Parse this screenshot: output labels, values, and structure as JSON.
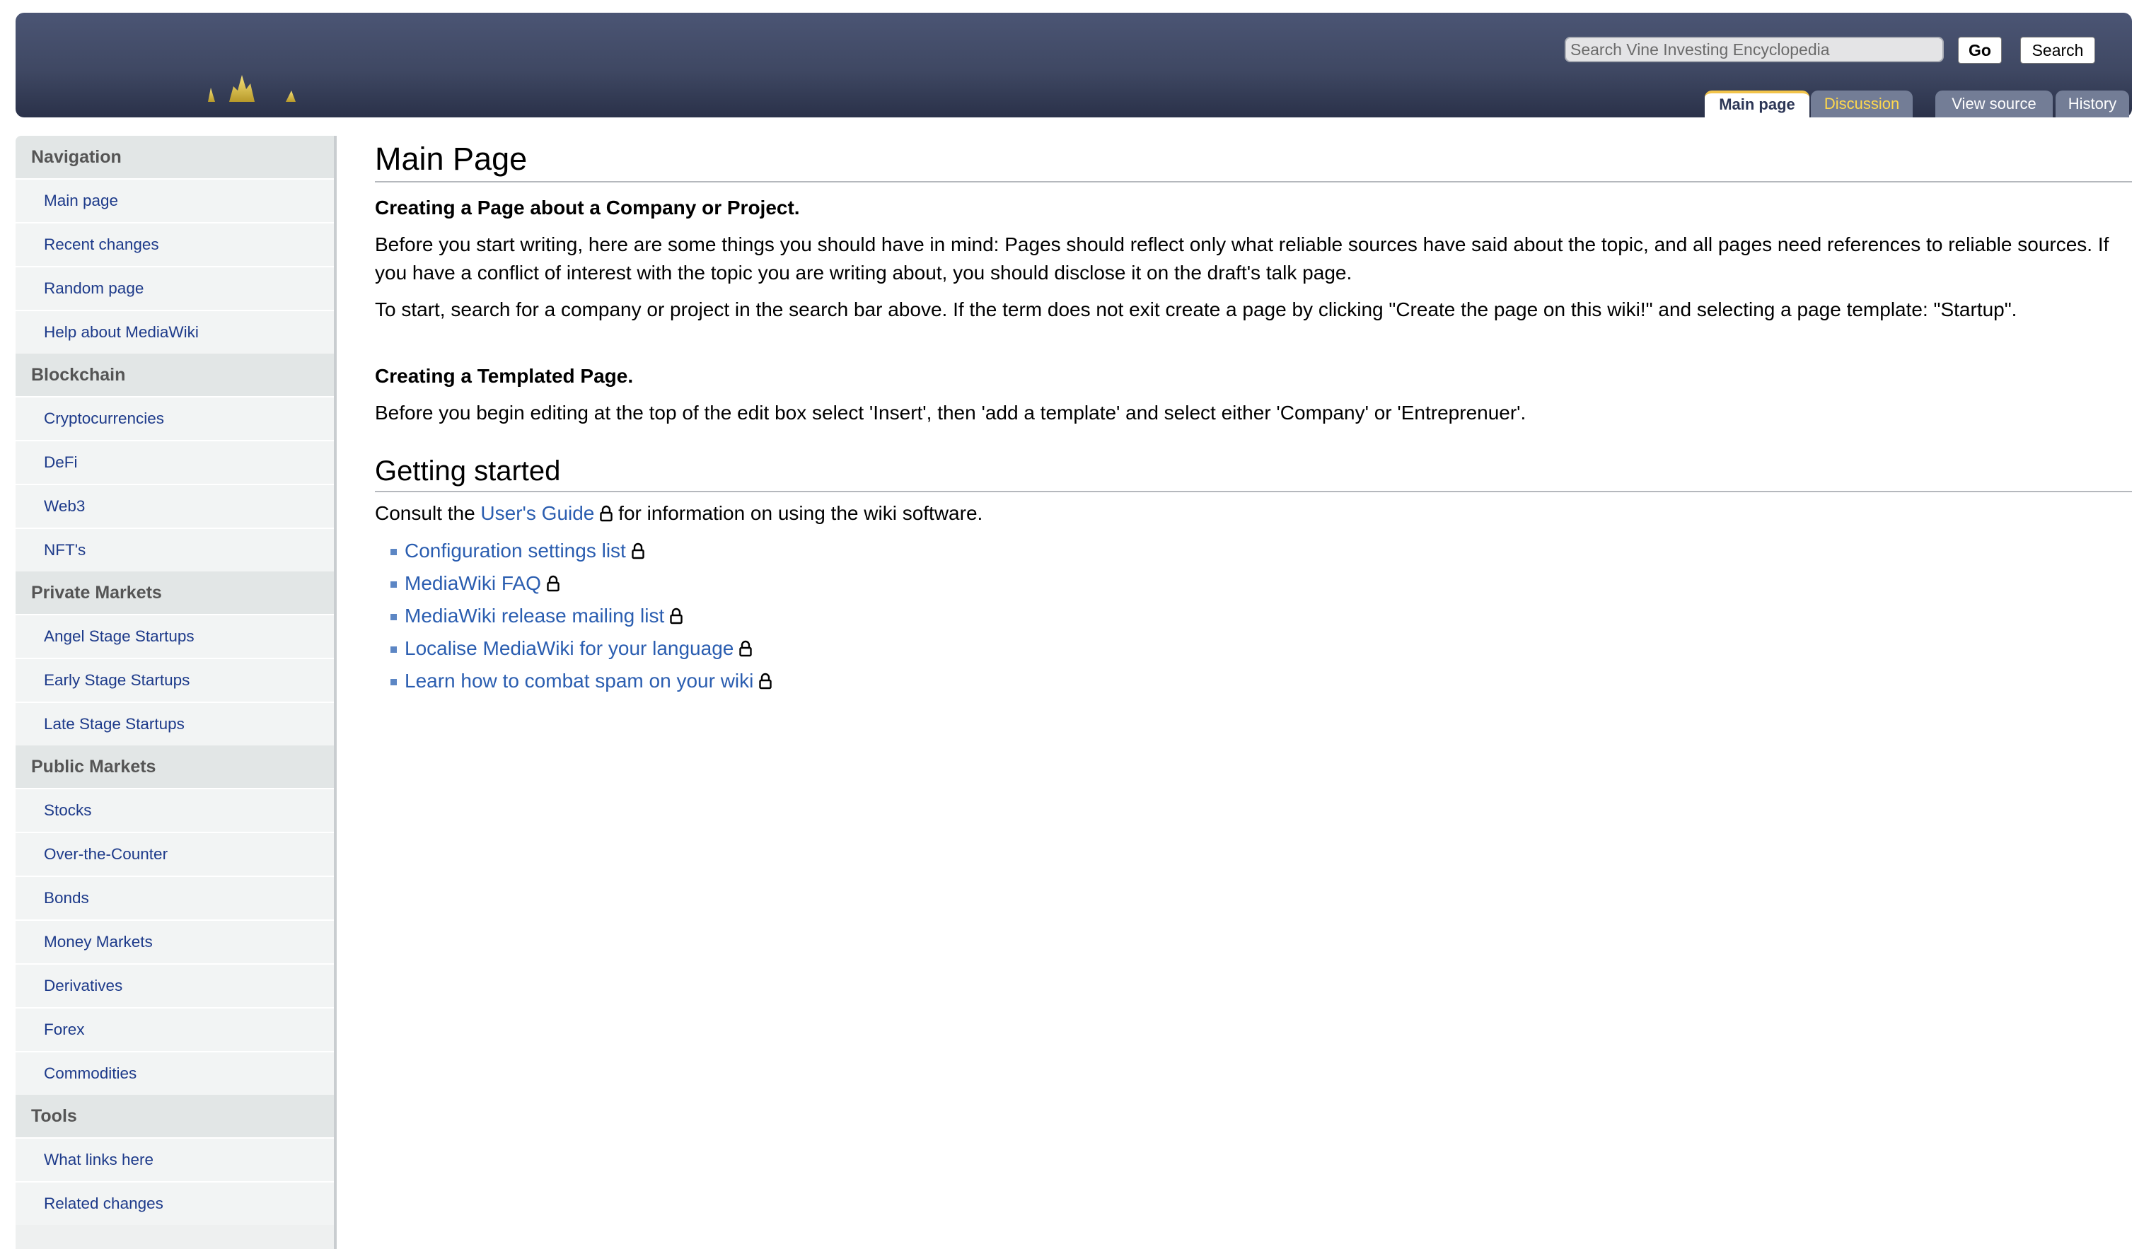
{
  "header": {
    "search_placeholder": "Search Vine Investing Encyclopedia",
    "go_label": "Go",
    "search_label": "Search",
    "tabs": {
      "main": "Main page",
      "discussion": "Discussion",
      "view_source": "View source",
      "history": "History"
    }
  },
  "sidebar": {
    "sections": [
      {
        "title": "Navigation",
        "items": [
          "Main page",
          "Recent changes",
          "Random page",
          "Help about MediaWiki"
        ]
      },
      {
        "title": "Blockchain",
        "items": [
          "Cryptocurrencies",
          "DeFi",
          "Web3",
          "NFT's"
        ]
      },
      {
        "title": "Private Markets",
        "items": [
          "Angel Stage Startups",
          "Early Stage Startups",
          "Late Stage Startups"
        ]
      },
      {
        "title": "Public Markets",
        "items": [
          "Stocks",
          "Over-the-Counter",
          "Bonds",
          "Money Markets",
          "Derivatives",
          "Forex",
          "Commodities"
        ]
      },
      {
        "title": "Tools",
        "items": [
          "What links here",
          "Related changes"
        ]
      }
    ]
  },
  "main": {
    "title": "Main Page",
    "section1_heading": "Creating a Page about a Company or Project.",
    "section1_p1": "Before you start writing, here are some things you should have in mind: Pages should reflect only what reliable sources have said about the topic, and all pages need references to reliable sources. If you have a conflict of interest with the topic you are writing about, you should disclose it on the draft's talk page.",
    "section1_p2": "To start, search for a company or project in the search bar above. If the term does not exit create a page by clicking \"Create the page on this wiki!\" and selecting a page template: \"Startup\".",
    "section2_heading": "Creating a Templated Page.",
    "section2_p1": "Before you begin editing at the top of the edit box select 'Insert', then 'add a template' and select either 'Company' or 'Entreprenuer'.",
    "getting_started_heading": "Getting started",
    "consult_prefix": "Consult the ",
    "consult_link": "User's Guide",
    "consult_suffix": " for information on using the wiki software.",
    "links": [
      "Configuration settings list",
      "MediaWiki FAQ",
      "MediaWiki release mailing list",
      "Localise MediaWiki for your language",
      "Learn how to combat spam on your wiki"
    ]
  },
  "colors": {
    "header_bg": "#434c68",
    "link": "#2a5db0",
    "sidebar_link": "#1d3a8a",
    "discussion_tab_text": "#ffd84d",
    "active_tab_accent": "#f2c44a"
  }
}
